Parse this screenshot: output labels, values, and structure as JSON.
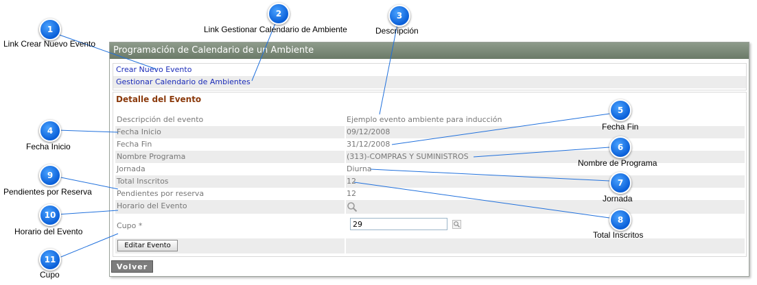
{
  "panel": {
    "title": "Programación de Calendario de un Ambiente"
  },
  "links": {
    "crear_evento": "Crear Nuevo Evento",
    "gestionar_calendario": "Gestionar Calendario de Ambientes"
  },
  "detail": {
    "title": "Detalle del Evento",
    "rows": [
      {
        "label": "Descripción del evento",
        "value": "Ejemplo evento ambiente para inducción"
      },
      {
        "label": "Fecha Inicio",
        "value": "09/12/2008"
      },
      {
        "label": "Fecha Fin",
        "value": "31/12/2008"
      },
      {
        "label": "Nombre Programa",
        "value": "(313)-COMPRAS Y SUMINISTROS"
      },
      {
        "label": "Jornada",
        "value": "Diurna"
      },
      {
        "label": "Total Inscritos",
        "value": "12"
      },
      {
        "label": "Pendientes por reserva",
        "value": "12"
      },
      {
        "label": "Horario del Evento",
        "value": ""
      }
    ],
    "cupo_label": "Cupo *",
    "cupo_value": "29",
    "edit_button": "Editar Evento"
  },
  "volver_button": "Volver",
  "callouts": [
    {
      "number": "1",
      "label": "Link Crear Nuevo Evento"
    },
    {
      "number": "2",
      "label": "Link Gestionar Calendario de Ambiente"
    },
    {
      "number": "3",
      "label": "Descripción"
    },
    {
      "number": "4",
      "label": "Fecha Inicio"
    },
    {
      "number": "5",
      "label": "Fecha Fin"
    },
    {
      "number": "6",
      "label": "Nombre de Programa"
    },
    {
      "number": "7",
      "label": "Jornada"
    },
    {
      "number": "8",
      "label": "Total Inscritos"
    },
    {
      "number": "9",
      "label": "Pendientes por Reserva"
    },
    {
      "number": "10",
      "label": "Horario del Evento"
    },
    {
      "number": "11",
      "label": "Cupo"
    }
  ],
  "icons": {
    "horario": "search-icon",
    "cupo": "search-icon"
  },
  "colors": {
    "header_bg": "#7a8877",
    "link": "#1a2bb8",
    "section_title": "#8b3a0c",
    "bubble": "#1477f0"
  }
}
